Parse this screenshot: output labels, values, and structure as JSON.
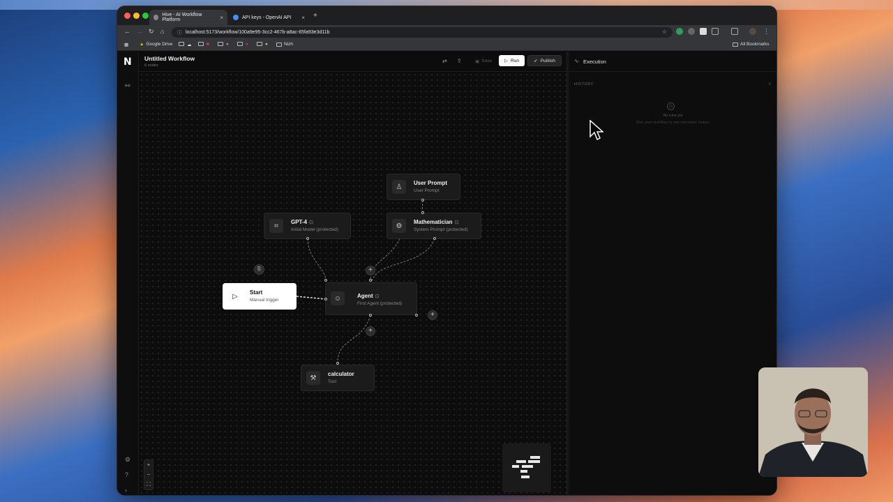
{
  "browser": {
    "tabs": [
      {
        "label": "Hive - AI Workflow Platform",
        "active": true
      },
      {
        "label": "API keys - OpenAI API",
        "active": false
      }
    ],
    "url": "localhost:5173/workflow/100a9e95-3cc2-467b-a8ac-65fa93e3d11b",
    "bookmarks": [
      "Google Drive",
      "Nizh"
    ],
    "all_bookmarks": "All Bookmarks"
  },
  "app": {
    "logo": "N",
    "workflow_title": "Untitled Workflow",
    "node_count": "6 nodes",
    "toolbar": {
      "save": "Save",
      "run": "Run",
      "publish": "Publish"
    }
  },
  "nodes": {
    "user_prompt": {
      "title": "User Prompt",
      "subtitle": "User Prompt"
    },
    "gpt4": {
      "title": "GPT-4",
      "subtitle": "Initial Model (protected)"
    },
    "mathematician": {
      "title": "Mathematician",
      "subtitle": "System Prompt (protected)"
    },
    "start": {
      "title": "Start",
      "subtitle": "Manual trigger"
    },
    "agent": {
      "title": "Agent",
      "subtitle": "First Agent (protected)"
    },
    "calculator": {
      "title": "calculator",
      "subtitle": "Tool"
    }
  },
  "execution": {
    "title": "Execution",
    "history_label": "HISTORY",
    "history_count": "0",
    "empty_title": "No runs yet",
    "empty_hint": "Run your workflow to see execution history"
  },
  "colors": {
    "accent": "#ffffff",
    "panel": "#1b1b1b",
    "background": "#0c0c0c"
  }
}
